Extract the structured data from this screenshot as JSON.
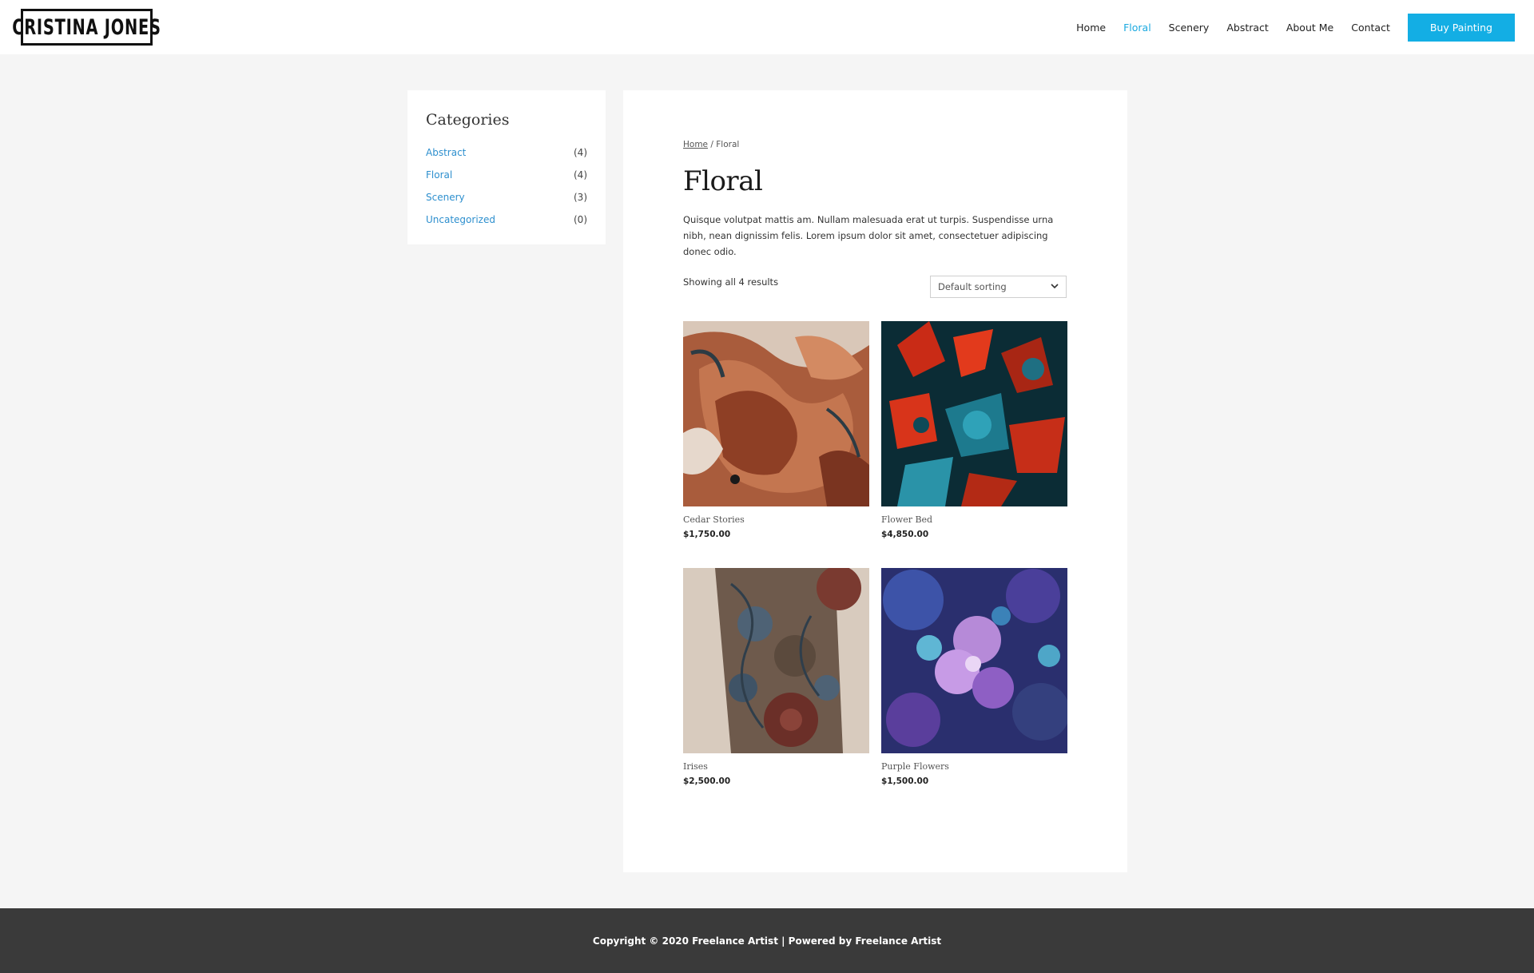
{
  "header": {
    "logo_text": "CRISTINA JONES",
    "nav": [
      {
        "label": "Home",
        "active": false
      },
      {
        "label": "Floral",
        "active": true
      },
      {
        "label": "Scenery",
        "active": false
      },
      {
        "label": "Abstract",
        "active": false
      },
      {
        "label": "About Me",
        "active": false
      },
      {
        "label": "Contact",
        "active": false
      }
    ],
    "cta_label": "Buy Painting",
    "accent_color": "#13aee4"
  },
  "sidebar": {
    "title": "Categories",
    "categories": [
      {
        "label": "Abstract",
        "count": "(4)"
      },
      {
        "label": "Floral",
        "count": "(4)"
      },
      {
        "label": "Scenery",
        "count": "(3)"
      },
      {
        "label": "Uncategorized",
        "count": "(0)"
      }
    ]
  },
  "main": {
    "breadcrumb": {
      "home": "Home",
      "separator": "/",
      "current": "Floral"
    },
    "title": "Floral",
    "description": "Quisque volutpat mattis am. Nullam malesuada erat ut turpis. Suspendisse urna nibh, nean dignissim felis. Lorem ipsum dolor sit amet, consectetuer adipiscing donec odio.",
    "result_count": "Showing all 4 results",
    "sort_selected": "Default sorting",
    "products": [
      {
        "name": "Cedar Stories",
        "price": "$1,750.00",
        "icon": "cedar-painting-image"
      },
      {
        "name": "Flower Bed",
        "price": "$4,850.00",
        "icon": "flower-bed-painting-image"
      },
      {
        "name": "Irises",
        "price": "$2,500.00",
        "icon": "irises-painting-image"
      },
      {
        "name": "Purple Flowers",
        "price": "$1,500.00",
        "icon": "purple-flowers-painting-image"
      }
    ]
  },
  "footer": {
    "copyright": "Copyright © 2020 Freelance Artist | Powered by Freelance Artist"
  }
}
